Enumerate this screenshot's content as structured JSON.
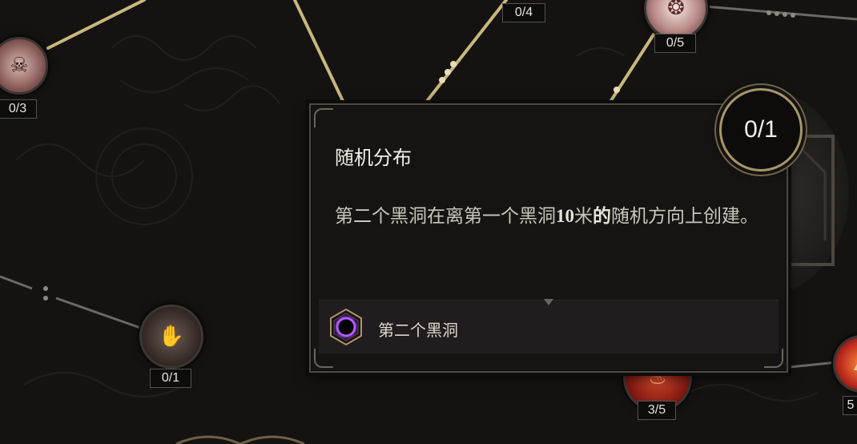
{
  "tooltip": {
    "title": "随机分布",
    "desc_parts": [
      "第二个黑洞在离第一个黑洞",
      "10",
      "米",
      "的",
      "随机方向上创建。"
    ],
    "rank": "0/1",
    "spell": {
      "name": "第二个黑洞",
      "icon": "black-hole-icon"
    }
  },
  "nodes": [
    {
      "id": "node-skull",
      "icon": "skull-icon",
      "counter": "0/3"
    },
    {
      "id": "node-top-center",
      "icon": "talent-icon",
      "counter": "0/4"
    },
    {
      "id": "node-top-right",
      "icon": "spirits-icon",
      "counter": "0/5"
    },
    {
      "id": "node-claws",
      "icon": "claws-icon",
      "counter": "0/1"
    },
    {
      "id": "node-fire",
      "icon": "fire-icon",
      "counter": "3/5"
    },
    {
      "id": "node-right-edge",
      "icon": "flame-icon",
      "counter": "5"
    }
  ],
  "colors": {
    "background": "#141311",
    "line_gold": "#c9b77c",
    "accent_gold": "#a89668",
    "footer_bg": "#211c1e"
  }
}
